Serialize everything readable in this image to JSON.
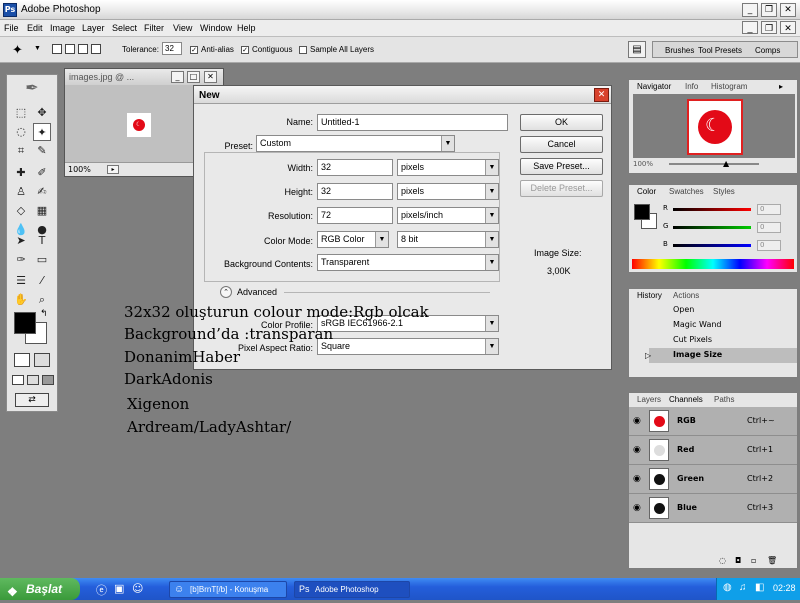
{
  "app": {
    "title": "Adobe Photoshop"
  },
  "menu": [
    "File",
    "Edit",
    "Image",
    "Layer",
    "Select",
    "Filter",
    "View",
    "Window",
    "Help"
  ],
  "options": {
    "tolerance_label": "Tolerance:",
    "tolerance_value": "32",
    "anti_alias": "Anti-alias",
    "contiguous": "Contiguous",
    "sample_all": "Sample All Layers",
    "well_tabs": [
      "Brushes",
      "Tool Presets",
      "Comps"
    ]
  },
  "image_window": {
    "title": "images.jpg @ ...",
    "zoom": "100%"
  },
  "dialog": {
    "title": "New",
    "name_label": "Name:",
    "name_value": "Untitled-1",
    "preset_label": "Preset:",
    "preset_value": "Custom",
    "width_label": "Width:",
    "width_value": "32",
    "width_unit": "pixels",
    "height_label": "Height:",
    "height_value": "32",
    "height_unit": "pixels",
    "resolution_label": "Resolution:",
    "resolution_value": "72",
    "resolution_unit": "pixels/inch",
    "color_mode_label": "Color Mode:",
    "color_mode_value": "RGB Color",
    "bit_depth": "8 bit",
    "background_label": "Background Contents:",
    "background_value": "Transparent",
    "advanced_label": "Advanced",
    "color_profile_label": "Color Profile:",
    "color_profile_value": "sRGB IEC61966-2.1",
    "pixel_aspect_label": "Pixel Aspect Ratio:",
    "pixel_aspect_value": "Square",
    "ok": "OK",
    "cancel": "Cancel",
    "save_preset": "Save Preset...",
    "delete_preset": "Delete Preset...",
    "image_size_label": "Image Size:",
    "image_size_value": "3,00K"
  },
  "navigator": {
    "tabs": [
      "Navigator",
      "Info",
      "Histogram"
    ],
    "zoom": "100%"
  },
  "color_panel": {
    "tabs": [
      "Color",
      "Swatches",
      "Styles"
    ],
    "channels": [
      "R",
      "G",
      "B"
    ],
    "values": [
      "0",
      "0",
      "0"
    ]
  },
  "history": {
    "tabs": [
      "History",
      "Actions"
    ],
    "items": [
      "Open",
      "Magic Wand",
      "Cut Pixels",
      "Image Size"
    ]
  },
  "layers": {
    "tabs": [
      "Layers",
      "Channels",
      "Paths"
    ],
    "channels": [
      {
        "name": "RGB",
        "shortcut": "Ctrl+~"
      },
      {
        "name": "Red",
        "shortcut": "Ctrl+1"
      },
      {
        "name": "Green",
        "shortcut": "Ctrl+2"
      },
      {
        "name": "Blue",
        "shortcut": "Ctrl+3"
      }
    ]
  },
  "overlay": [
    "32x32 oluşturun colour mode:Rgb olcak",
    "Background’da :transparan",
    "DonanimHaber",
    "DarkAdonis",
    "Xigenon",
    "Ardream/LadyAshtar/"
  ],
  "taskbar": {
    "start": "Başlat",
    "tasks": [
      "[b]BrnT[/b] - Konuşma",
      "Adobe Photoshop"
    ],
    "clock": "02:28"
  },
  "colors": {
    "flag_red": "#e30a17",
    "taskbar_blue": "#245edb",
    "start_green": "#3a9a3a"
  }
}
